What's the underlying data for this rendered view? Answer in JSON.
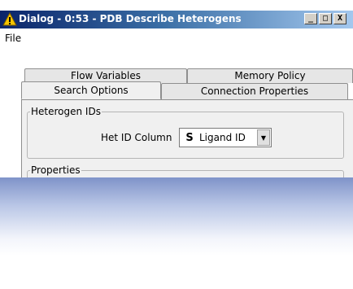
{
  "window": {
    "title": "Dialog - 0:53 - PDB Describe Heterogens",
    "minimize_glyph": "_",
    "maximize_glyph": "□",
    "close_glyph": "X"
  },
  "menu": {
    "items": [
      {
        "label": "File"
      }
    ]
  },
  "tabs": {
    "back_row": [
      {
        "label": "Flow Variables"
      },
      {
        "label": "Memory Policy"
      }
    ],
    "front_row": [
      {
        "label": "Search Options",
        "active": true
      },
      {
        "label": "Connection Properties",
        "active": false
      }
    ]
  },
  "heterogen_group": {
    "title": "Heterogen IDs",
    "column_label": "Het ID Column",
    "column_type_glyph": "S",
    "column_value": "Ligand ID"
  },
  "properties_group": {
    "title": "Properties"
  },
  "colors": {
    "titlebar_start": "#0a246a",
    "titlebar_end": "#a6caf0",
    "panel_bg": "#f0f0f0"
  }
}
